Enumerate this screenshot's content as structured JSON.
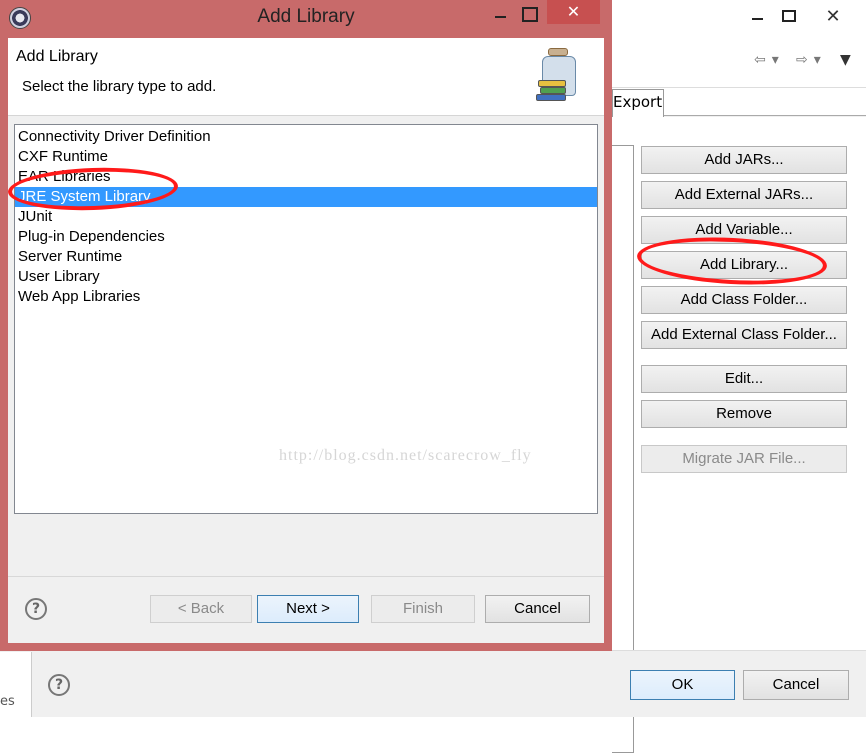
{
  "dialog": {
    "title": "Add Library",
    "header_title": "Add Library",
    "header_description": "Select the library type to add.",
    "library_types": [
      "Connectivity Driver Definition",
      "CXF Runtime",
      "EAR Libraries",
      "JRE System Library",
      "JUnit",
      "Plug-in Dependencies",
      "Server Runtime",
      "User Library",
      "Web App Libraries"
    ],
    "selected_library": "JRE System Library",
    "watermark": "http://blog.csdn.net/scarecrow_fly",
    "buttons": {
      "back": "< Back",
      "next": "Next >",
      "finish": "Finish",
      "cancel": "Cancel"
    },
    "help_symbol": "?",
    "close_symbol": "✕",
    "icon": "library-jar-icon"
  },
  "background": {
    "tab_label": "Export",
    "build_path_buttons": [
      {
        "label": "Add JARs...",
        "enabled": true
      },
      {
        "label": "Add External JARs...",
        "enabled": true
      },
      {
        "label": "Add Variable...",
        "enabled": true
      },
      {
        "label": "Add Library...",
        "enabled": true
      },
      {
        "label": "Add Class Folder...",
        "enabled": true
      },
      {
        "label": "Add External Class Folder...",
        "enabled": true
      },
      {
        "label": "Edit...",
        "enabled": true
      },
      {
        "label": "Remove",
        "enabled": true
      },
      {
        "label": "Migrate JAR File...",
        "enabled": false
      }
    ],
    "ok_label": "OK",
    "cancel_label": "Cancel",
    "help_symbol": "?",
    "left_fragment": "es",
    "close_symbol": "✕"
  },
  "colors": {
    "dialog_frame": "#c86a6a",
    "selection": "#3399ff",
    "annotation": "#ff1a1a"
  }
}
